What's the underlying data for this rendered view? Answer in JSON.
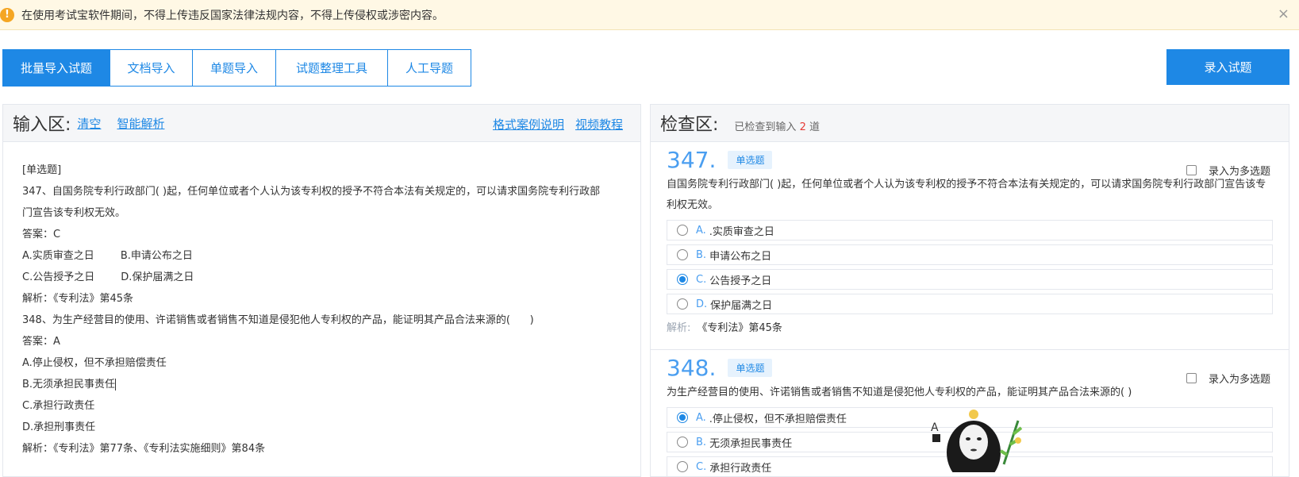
{
  "notice": {
    "icon": "warning-icon",
    "text": "在使用考试宝软件期间，不得上传违反国家法律法规内容，不得上传侵权或涉密内容。",
    "close": "×"
  },
  "tabs": [
    {
      "label": "批量导入试题",
      "active": true
    },
    {
      "label": "文档导入"
    },
    {
      "label": "单题导入"
    },
    {
      "label": "试题整理工具"
    },
    {
      "label": "人工导题"
    }
  ],
  "enter_button": "录入试题",
  "left": {
    "title": "输入区:",
    "clear": "清空",
    "smart_parse": "智能解析",
    "format_help": "格式案例说明",
    "video": "视频教程",
    "lines": [
      "[单选题]",
      "347、自国务院专利行政部门(      )起，任何单位或者个人认为该专利权的授予不符合本法有关规定的，可以请求国务院专利行政部",
      "门宣告该专利权无效。",
      "答案：C",
      "A.实质审查之日        B.申请公布之日",
      "C.公告授予之日        D.保护届满之日",
      "解析：《专利法》第45条",
      "348、为生产经营目的使用、许诺销售或者销售不知道是侵犯他人专利权的产品，能证明其产品合法来源的(      )",
      "答案：A",
      "A.停止侵权，但不承担赔偿责任",
      "B.无须承担民事责任",
      "C.承担行政责任",
      "D.承担刑事责任",
      "解析：《专利法》第77条、《专利法实施细则》第84条"
    ]
  },
  "right": {
    "title": "检查区:",
    "checked_prefix": "已检查到输入",
    "checked_count": "2",
    "checked_suffix": "道",
    "questions": [
      {
        "number": "347.",
        "type": "单选题",
        "multi_label": "录入为多选题",
        "stem": "自国务院专利行政部门( )起，任何单位或者个人认为该专利权的授予不符合本法有关规定的，可以请求国务院专利行政部门宣告该专利权无效。",
        "options": [
          {
            "letter": "A.",
            "text": ".实质审查之日",
            "selected": false
          },
          {
            "letter": "B.",
            "text": "申请公布之日",
            "selected": false
          },
          {
            "letter": "C.",
            "text": "公告授予之日",
            "selected": true
          },
          {
            "letter": "D.",
            "text": "保护届满之日",
            "selected": false
          }
        ],
        "analysis_label": "解析:",
        "analysis": "《专利法》第45条"
      },
      {
        "number": "348.",
        "type": "单选题",
        "multi_label": "录入为多选题",
        "stem": "为生产经营目的使用、许诺销售或者销售不知道是侵犯他人专利权的产品，能证明其产品合法来源的( )",
        "options": [
          {
            "letter": "A.",
            "text": ".停止侵权，但不承担赔偿责任",
            "selected": true
          },
          {
            "letter": "B.",
            "text": "无须承担民事责任",
            "selected": false
          },
          {
            "letter": "C.",
            "text": "承担行政责任",
            "selected": false
          }
        ]
      }
    ]
  },
  "mascot": "no-face-mascot-icon",
  "colors": {
    "primary": "#1e88e5",
    "warning": "#f5a623",
    "notice_bg": "#fff8e5",
    "count": "#e53935"
  }
}
